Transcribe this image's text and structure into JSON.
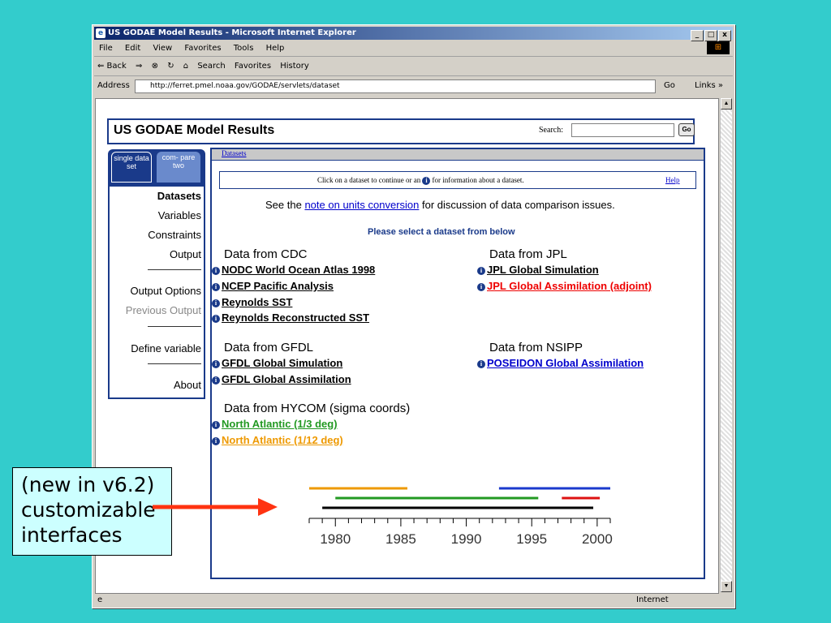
{
  "window": {
    "title": "US GODAE Model Results - Microsoft Internet Explorer",
    "controls": [
      "_",
      "□",
      "x"
    ]
  },
  "menu": [
    "File",
    "Edit",
    "View",
    "Favorites",
    "Tools",
    "Help"
  ],
  "toolbar": {
    "back": "⇐ Back",
    "forward": "⇒",
    "stop": "⊗",
    "refresh": "↻",
    "home": "⌂",
    "search": "Search",
    "favorites": "Favorites",
    "history": "History"
  },
  "address": {
    "label": "Address",
    "url": "http://ferret.pmel.noaa.gov/GODAE/servlets/dataset",
    "go": "Go",
    "links": "Links »"
  },
  "status": {
    "zone": "Internet"
  },
  "page": {
    "title": "US GODAE Model Results",
    "search_label": "Search:",
    "search_value": "",
    "go": "Go",
    "tabs": {
      "single": "single data set",
      "compare": "com- pare two"
    },
    "nav": {
      "datasets": "Datasets",
      "variables": "Variables",
      "constraints": "Constraints",
      "output": "Output",
      "output_options": "Output Options",
      "previous_output": "Previous Output",
      "define_variable": "Define variable",
      "about": "About"
    },
    "breadcrumb": "Datasets",
    "instruction_pre": "Click on a dataset to continue or an",
    "instruction_post": "for information about a dataset.",
    "help": "Help",
    "note_pre": "See the",
    "note_link": "note on units conversion",
    "note_post": "for discussion of data comparison issues.",
    "please": "Please select a dataset from below",
    "groups": {
      "cdc": {
        "title": "Data from CDC",
        "items": [
          "NODC World Ocean Atlas 1998",
          "NCEP Pacific Analysis",
          "Reynolds SST",
          "Reynolds Reconstructed SST"
        ]
      },
      "jpl": {
        "title": "Data from JPL",
        "items": [
          "JPL Global Simulation",
          "JPL Global Assimilation (adjoint)"
        ]
      },
      "gfdl": {
        "title": "Data from GFDL",
        "items": [
          "GFDL Global Simulation",
          "GFDL Global Assimilation"
        ]
      },
      "nsipp": {
        "title": "Data from NSIPP",
        "items": [
          "POSEIDON Global Assimilation"
        ]
      },
      "hycom": {
        "title": "Data from HYCOM (sigma coords)",
        "items": [
          "North Atlantic (1/3 deg)",
          "North Atlantic (1/12 deg)"
        ]
      }
    },
    "timeline": {
      "ticks": [
        "1980",
        "1985",
        "1990",
        "1995",
        "2000"
      ],
      "range": [
        1978,
        2001
      ],
      "bars": [
        {
          "color": "#ee9900",
          "start": 1978,
          "end": 1985.5
        },
        {
          "color": "#1a3acc",
          "start": 1992.5,
          "end": 2001
        },
        {
          "color": "#229922",
          "start": 1980,
          "end": 1995.5
        },
        {
          "color": "#dd1111",
          "start": 1997.3,
          "end": 2000.2
        },
        {
          "color": "#000000",
          "start": 1979,
          "end": 1999.7
        }
      ]
    }
  },
  "callout": {
    "line1": "(new in v6.2)",
    "line2": "customizable",
    "line3": "interfaces"
  },
  "colors": {
    "desktop": "#33cccc",
    "arrow": "#ff3311",
    "navy": "#1a3a8a"
  }
}
